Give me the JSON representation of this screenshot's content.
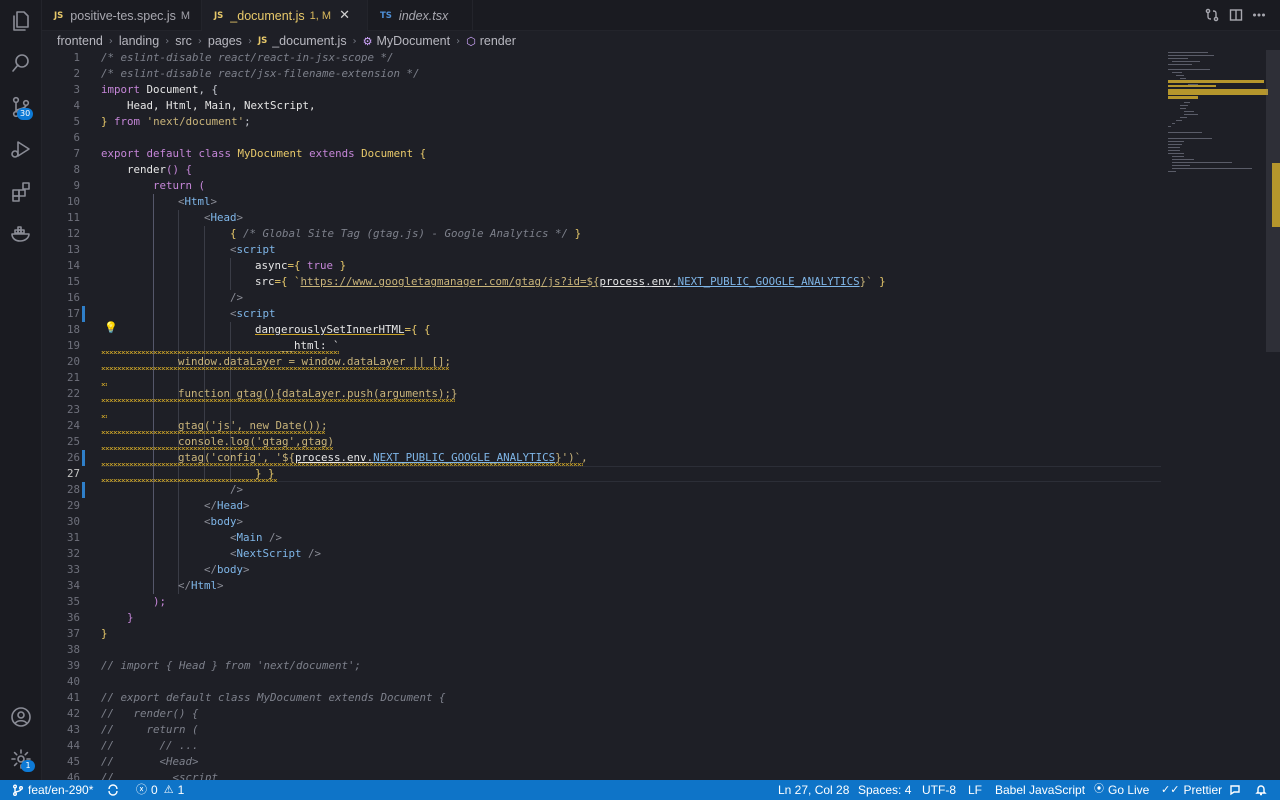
{
  "tabs": [
    {
      "lang": "JS",
      "name": "positive-tes.spec.js",
      "status": "M"
    },
    {
      "lang": "JS",
      "name": "_document.js",
      "status": "1, M"
    },
    {
      "lang": "TS",
      "name": "index.tsx",
      "status": ""
    }
  ],
  "breadcrumb": {
    "items": [
      "frontend",
      "landing",
      "src",
      "pages"
    ],
    "file_badge": "JS",
    "file": "_document.js",
    "class_name": "MyDocument",
    "method": "render"
  },
  "activity": {
    "scm_badge": "30",
    "settings_badge": "1"
  },
  "editor": {
    "current_line": 27,
    "line_numbers": [
      "1",
      "2",
      "3",
      "4",
      "5",
      "6",
      "7",
      "8",
      "9",
      "10",
      "11",
      "12",
      "13",
      "14",
      "15",
      "16",
      "17",
      "18",
      "19",
      "20",
      "21",
      "22",
      "23",
      "24",
      "25",
      "26",
      "27",
      "28",
      "29",
      "30",
      "31",
      "32",
      "33",
      "34",
      "35",
      "36",
      "37",
      "38",
      "39",
      "40",
      "41",
      "42",
      "43",
      "44",
      "45",
      "46"
    ],
    "code": {
      "l1": "/* eslint-disable react/react-in-jsx-scope */",
      "l2": "/* eslint-disable react/jsx-filename-extension */",
      "l3a": "import",
      "l3b": "Document",
      "l3c": ", {",
      "l4": "Head, Html, Main, NextScript,",
      "l5a": "}",
      "l5b": "from",
      "l5c": "'next/document'",
      "l5d": ";",
      "l7a": "export default class",
      "l7b": "MyDocument",
      "l7c": "extends",
      "l7d": "Document",
      "l7e": "{",
      "l8a": "render",
      "l8b": "() {",
      "l9a": "return",
      "l9b": "(",
      "l10": "Html",
      "l11": "Head",
      "l12a": "{",
      "l12b": "/* Global Site Tag (gtag.js) - Google Analytics */",
      "l12c": "}",
      "l13": "script",
      "l14a": "async",
      "l14b": "={",
      "l14c": "true",
      "l14d": "}",
      "l15a": "src",
      "l15b": "={ `",
      "l15c": "https://www.googletagmanager.com/gtag/js?id=${",
      "l15d": "process",
      "l15e": ".",
      "l15f": "env",
      "l15g": ".",
      "l15h": "NEXT_PUBLIC_GOOGLE_ANALYTICS",
      "l15i": "}`",
      "l15j": "}",
      "l16": "/>",
      "l17": "script",
      "l18a": "dangerouslySetInnerHTML",
      "l18b": "={ {",
      "l19": "__html: `",
      "l20": "window.dataLayer = window.dataLayer || [];",
      "l21": "",
      "l22": "function gtag(){dataLayer.push(arguments);}",
      "l23": "",
      "l24": "gtag('js', new Date());",
      "l25": "console.log('gtag',gtag)",
      "l26a": "gtag('config', '${",
      "l26b": "process",
      "l26c": ".",
      "l26d": "env",
      "l26e": ".",
      "l26f": "NEXT_PUBLIC_GOOGLE_ANALYTICS",
      "l26g": "}')`,",
      "l27": "} }",
      "l28": "/>",
      "l29": "Head",
      "l30": "body",
      "l31": "Main",
      "l32": "NextScript",
      "l33": "body",
      "l34": "Html",
      "l35": ");",
      "l36": "}",
      "l37": "}",
      "l39": "// import { Head } from 'next/document';",
      "l41": "// export default class MyDocument extends Document {",
      "l42": "//   render() {",
      "l43": "//     return (",
      "l44": "//       // ...",
      "l45": "//       <Head>",
      "l46": "//         <script"
    }
  },
  "status": {
    "branch": "feat/en-290*",
    "errors": "0",
    "warnings": "1",
    "position": "Ln 27, Col 28",
    "spaces": "Spaces: 4",
    "encoding": "UTF-8",
    "eol": "LF",
    "language": "Babel JavaScript",
    "go_live": "Go Live",
    "prettier": "Prettier"
  }
}
